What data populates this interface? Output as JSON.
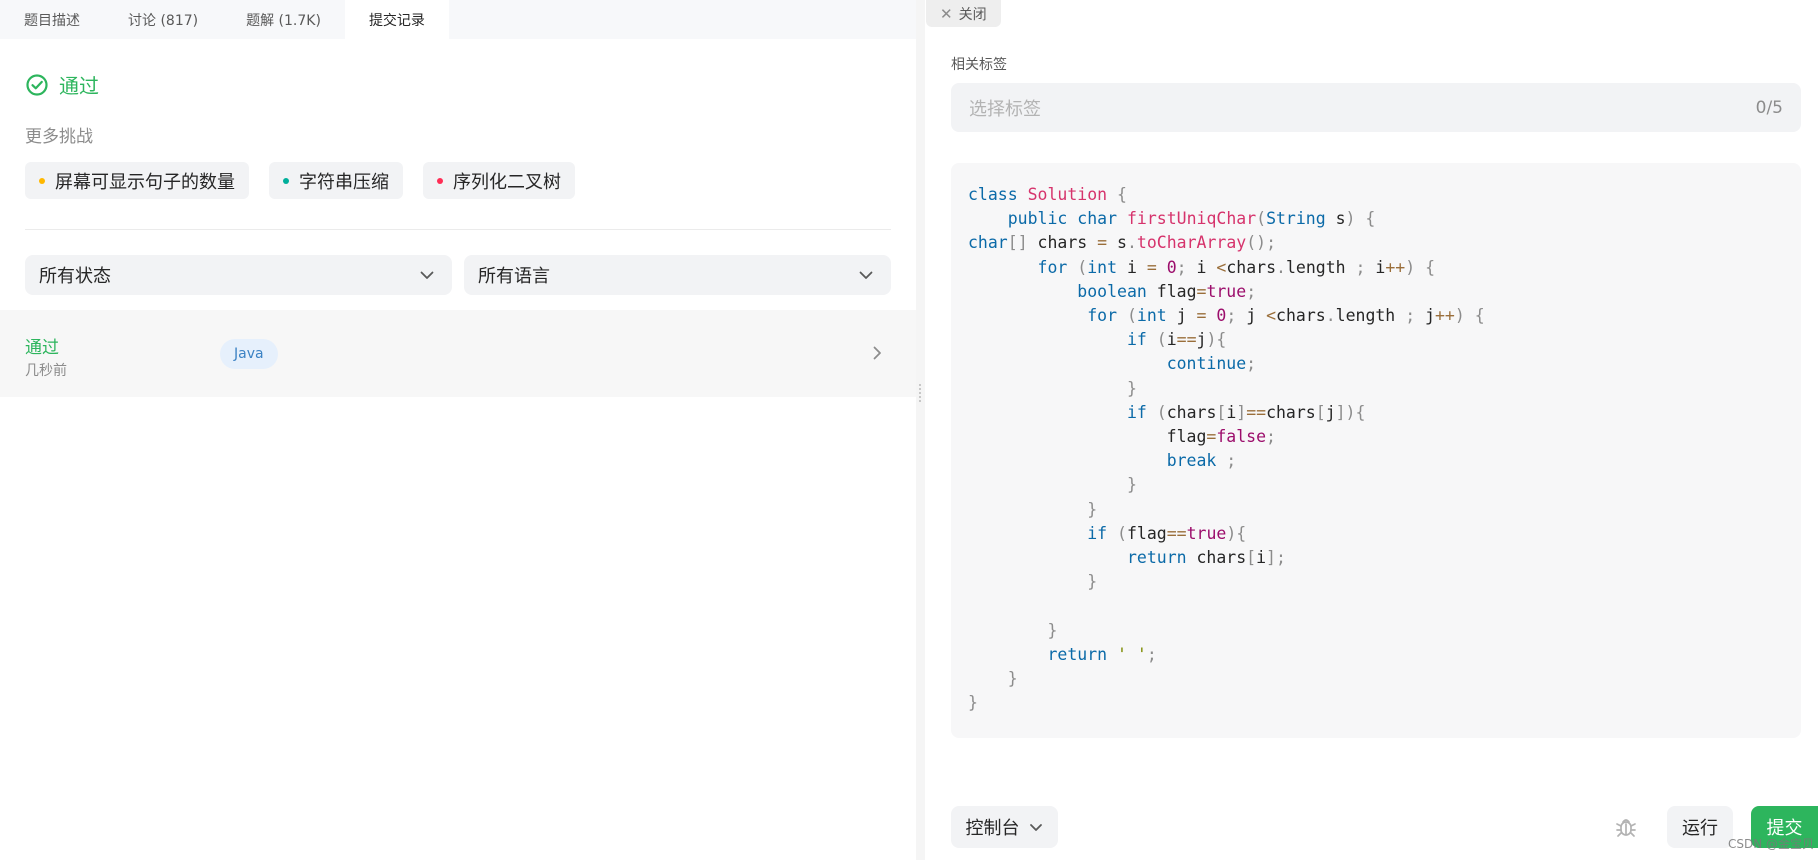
{
  "tabs": [
    {
      "label": "题目描述"
    },
    {
      "label": "讨论 (817)"
    },
    {
      "label": "题解 (1.7K)"
    },
    {
      "label": "提交记录"
    }
  ],
  "result": {
    "status": "通过"
  },
  "more_challenges": {
    "title": "更多挑战",
    "items": [
      {
        "label": "屏幕可显示句子的数量",
        "color": "#ffb800"
      },
      {
        "label": "字符串压缩",
        "color": "#00af9b"
      },
      {
        "label": "序列化二叉树",
        "color": "#ff2d55"
      }
    ]
  },
  "filters": {
    "status": "所有状态",
    "language": "所有语言"
  },
  "submission": {
    "status": "通过",
    "time": "几秒前",
    "language": "Java"
  },
  "close": {
    "label": "关闭"
  },
  "tags": {
    "label": "相关标签",
    "placeholder": "选择标签",
    "count": "0/5"
  },
  "code": {
    "language": "Java",
    "source": "class Solution {\n    public char firstUniqChar(String s) {\nchar[] chars = s.toCharArray();\n       for (int i = 0; i <chars.length ; i++) {\n           boolean flag=true;\n            for (int j = 0; j <chars.length ; j++) {\n                if (i==j){\n                    continue;\n                }\n                if (chars[i]==chars[j]){\n                    flag=false;\n                    break ;\n                }\n            }\n            if (flag==true){\n                return chars[i];\n            }\n\n        }\n        return ' ';\n    }\n}"
  },
  "footer": {
    "console": "控制台",
    "run": "运行",
    "submit": "提交",
    "watermark": "CSDN @金宝贝"
  },
  "colors": {
    "accent": "#2db55d",
    "code_bg": "#f7f7f8"
  }
}
